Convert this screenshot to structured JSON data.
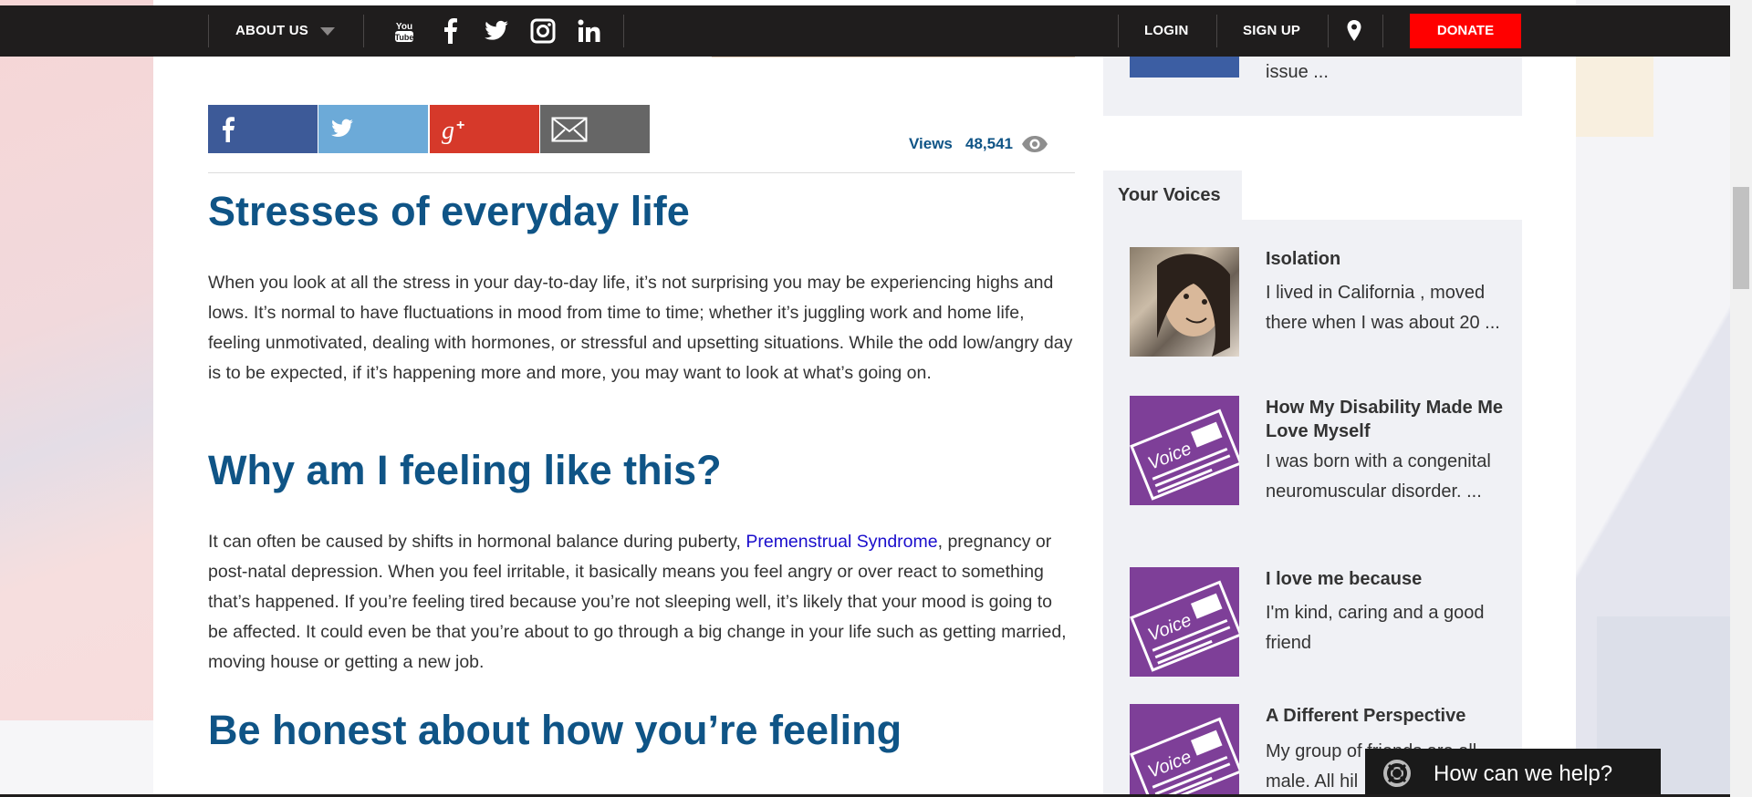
{
  "nav": {
    "about_label": "ABOUT US",
    "login_label": "LOGIN",
    "signup_label": "SIGN UP",
    "donate_label": "DONATE",
    "social_icons": [
      "youtube-icon",
      "facebook-icon",
      "twitter-icon",
      "instagram-icon",
      "linkedin-icon"
    ]
  },
  "share": {
    "buttons": [
      "facebook-share",
      "twitter-share",
      "google-plus-share",
      "email-share"
    ]
  },
  "views": {
    "label": "Views",
    "count": "48,541"
  },
  "article": {
    "heading1": "Stresses of everyday life",
    "para1": "When you look at all the stress in your day-to-day life, it’s not surprising you may be experiencing highs and lows. It’s normal to have fluctuations in mood from time to time; whether it’s juggling work and home life, feeling unmotivated, dealing with hormones, or stressful and upsetting situations. While the odd low/angry day is to be expected, if it’s happening more and more, you may want to look at what’s going on.",
    "heading2": "Why am I feeling like this?",
    "para2_before": "It can often be caused by shifts in hormonal balance during puberty, ",
    "para2_link": "Premenstrual Syndrome",
    "para2_after": ", pregnancy or post-natal depression. When you feel irritable, it basically means you feel angry or over react to something that’s happened. If you’re feeling tired because you’re not sleeping well, it’s likely that your mood is going to be affected. It could even be that you’re about to go through a big change in your life such as getting married, moving house or getting a new job.",
    "heading3": "Be honest about how you’re feeling"
  },
  "sidebar": {
    "top_snippet": "issue ...",
    "tab_label": "Your Voices",
    "voices": [
      {
        "title": "Isolation",
        "text": "I lived in California , moved there when I was about 20 ..."
      },
      {
        "title": "How My Disability Made Me Love Myself",
        "text": "I was born with a congenital neuromuscular disorder. ..."
      },
      {
        "title": "I love me because",
        "text": "I'm kind, caring and a good friend"
      },
      {
        "title": "A Different Perspective",
        "text": "My group of friends are all male. All hil"
      }
    ],
    "thumb_label": "Voice"
  },
  "help": {
    "label": "How can we help?"
  },
  "colors": {
    "nav_bg": "#1f1d1d",
    "donate": "#ff0000",
    "heading": "#0f5486",
    "voice_thumb": "#7e3f98"
  }
}
